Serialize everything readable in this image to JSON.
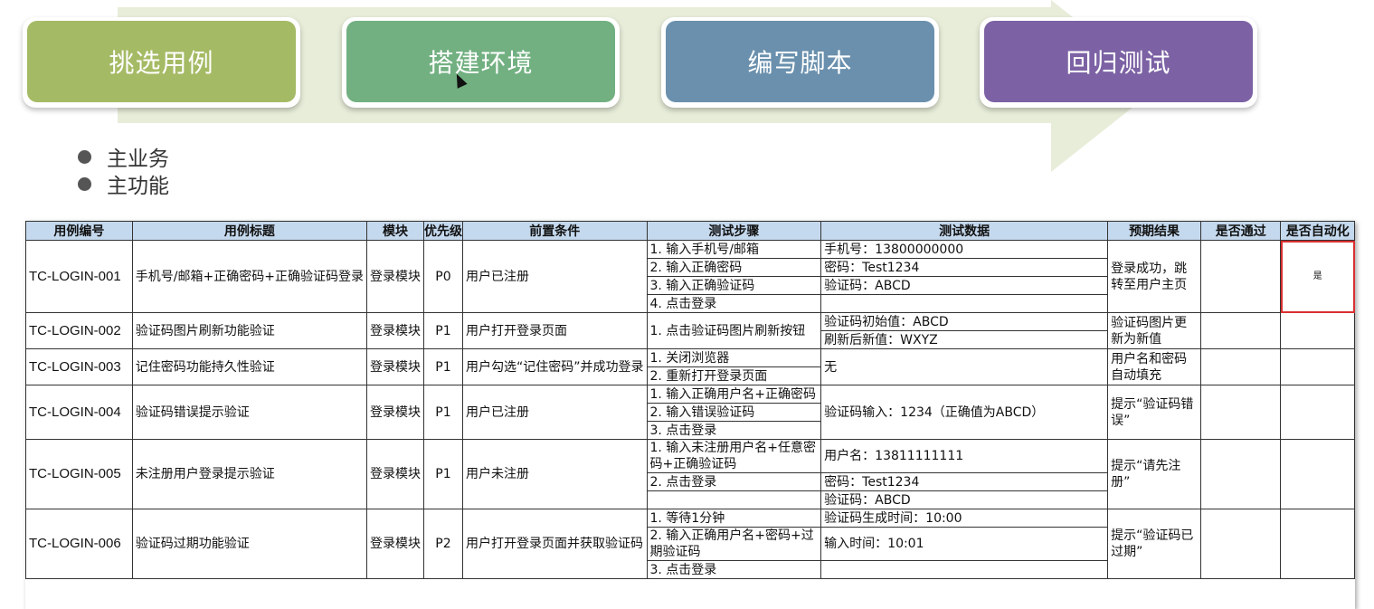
{
  "flow": {
    "steps": [
      {
        "label": "挑选用例",
        "color": "#a5ba64"
      },
      {
        "label": "搭建环境",
        "color": "#72b081"
      },
      {
        "label": "编写脚本",
        "color": "#6a90ad"
      },
      {
        "label": "回归测试",
        "color": "#7c62a4"
      }
    ]
  },
  "bullets": [
    "主业务",
    "主功能"
  ],
  "table": {
    "headers": [
      "用例编号",
      "用例标题",
      "模块",
      "优先级",
      "前置条件",
      "测试步骤",
      "测试数据",
      "预期结果",
      "是否通过",
      "是否自动化"
    ],
    "rows": [
      {
        "id": "TC-LOGIN-001",
        "title": "手机号/邮箱+正确密码+正确验证码登录",
        "module": "登录模块",
        "priority": "P0",
        "precondition": "用户已注册",
        "steps": [
          "1. 输入手机号/邮箱",
          "2. 输入正确密码",
          "3. 输入正确验证码",
          "4. 点击登录"
        ],
        "data": [
          "手机号：13800000000",
          "密码：Test1234",
          "验证码：ABCD"
        ],
        "expected": "登录成功，跳转至用户主页",
        "passed": "",
        "automated": "是"
      },
      {
        "id": "TC-LOGIN-002",
        "title": "验证码图片刷新功能验证",
        "module": "登录模块",
        "priority": "P1",
        "precondition": "用户打开登录页面",
        "steps": [
          "1. 点击验证码图片刷新按钮"
        ],
        "data": [
          "验证码初始值：ABCD",
          "刷新后新值：WXYZ"
        ],
        "expected": "验证码图片更新为新值",
        "passed": "",
        "automated": ""
      },
      {
        "id": "TC-LOGIN-003",
        "title": "记住密码功能持久性验证",
        "module": "登录模块",
        "priority": "P1",
        "precondition": "用户勾选“记住密码”并成功登录",
        "steps": [
          "1. 关闭浏览器",
          "2. 重新打开登录页面"
        ],
        "data": [
          "无"
        ],
        "expected": "用户名和密码自动填充",
        "passed": "",
        "automated": ""
      },
      {
        "id": "TC-LOGIN-004",
        "title": "验证码错误提示验证",
        "module": "登录模块",
        "priority": "P1",
        "precondition": "用户已注册",
        "steps": [
          "1. 输入正确用户名+正确密码",
          "2. 输入错误验证码",
          "3. 点击登录"
        ],
        "data": [
          "验证码输入：1234（正确值为ABCD）"
        ],
        "expected": "提示“验证码错误”",
        "passed": "",
        "automated": ""
      },
      {
        "id": "TC-LOGIN-005",
        "title": "未注册用户登录提示验证",
        "module": "登录模块",
        "priority": "P1",
        "precondition": "用户未注册",
        "steps": [
          "1. 输入未注册用户名+任意密码+正确验证码",
          "2. 点击登录"
        ],
        "data": [
          "用户名：13811111111",
          "密码：Test1234",
          "验证码：ABCD"
        ],
        "expected": "提示“请先注册”",
        "passed": "",
        "automated": ""
      },
      {
        "id": "TC-LOGIN-006",
        "title": "验证码过期功能验证",
        "module": "登录模块",
        "priority": "P2",
        "precondition": "用户打开登录页面并获取验证码",
        "steps": [
          "1. 等待1分钟",
          "2. 输入正确用户名+密码+过期验证码",
          "3. 点击登录"
        ],
        "data": [
          "验证码生成时间：10:00",
          "输入时间：10:01"
        ],
        "expected": "提示“验证码已过期”",
        "passed": "",
        "automated": ""
      }
    ]
  }
}
